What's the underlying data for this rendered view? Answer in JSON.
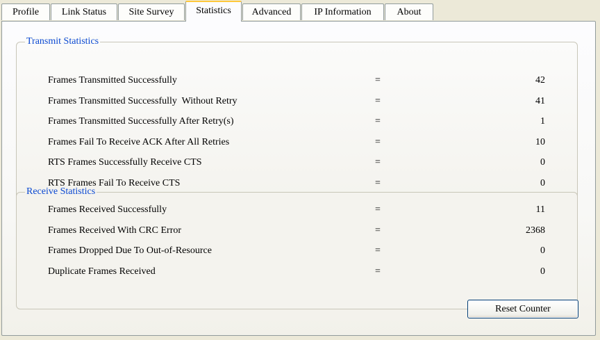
{
  "tabs": [
    {
      "label": "Profile"
    },
    {
      "label": "Link Status"
    },
    {
      "label": "Site Survey"
    },
    {
      "label": "Statistics"
    },
    {
      "label": "Advanced"
    },
    {
      "label": "IP Information"
    },
    {
      "label": "About"
    }
  ],
  "active_tab": "Statistics",
  "transmit": {
    "title": "Transmit Statistics",
    "rows": [
      {
        "label": "Frames Transmitted Successfully",
        "eq": "=",
        "value": "42"
      },
      {
        "label": "Frames Transmitted Successfully  Without Retry",
        "eq": "=",
        "value": "41"
      },
      {
        "label": "Frames Transmitted Successfully After Retry(s)",
        "eq": "=",
        "value": "1"
      },
      {
        "label": "Frames Fail To Receive ACK After All Retries",
        "eq": "=",
        "value": "10"
      },
      {
        "label": "RTS Frames Successfully Receive CTS",
        "eq": "=",
        "value": "0"
      },
      {
        "label": "RTS Frames Fail To Receive CTS",
        "eq": "=",
        "value": "0"
      }
    ]
  },
  "receive": {
    "title": "Receive Statistics",
    "rows": [
      {
        "label": "Frames Received Successfully",
        "eq": "=",
        "value": "11"
      },
      {
        "label": "Frames Received With CRC Error",
        "eq": "=",
        "value": "2368"
      },
      {
        "label": "Frames Dropped Due To Out-of-Resource",
        "eq": "=",
        "value": "0"
      },
      {
        "label": "Duplicate Frames Received",
        "eq": "=",
        "value": "0"
      }
    ]
  },
  "reset_button": "Reset Counter",
  "colors": {
    "legend": "#0a48d2",
    "tab_highlight": "#ffc83c",
    "border": "#919b9c"
  }
}
